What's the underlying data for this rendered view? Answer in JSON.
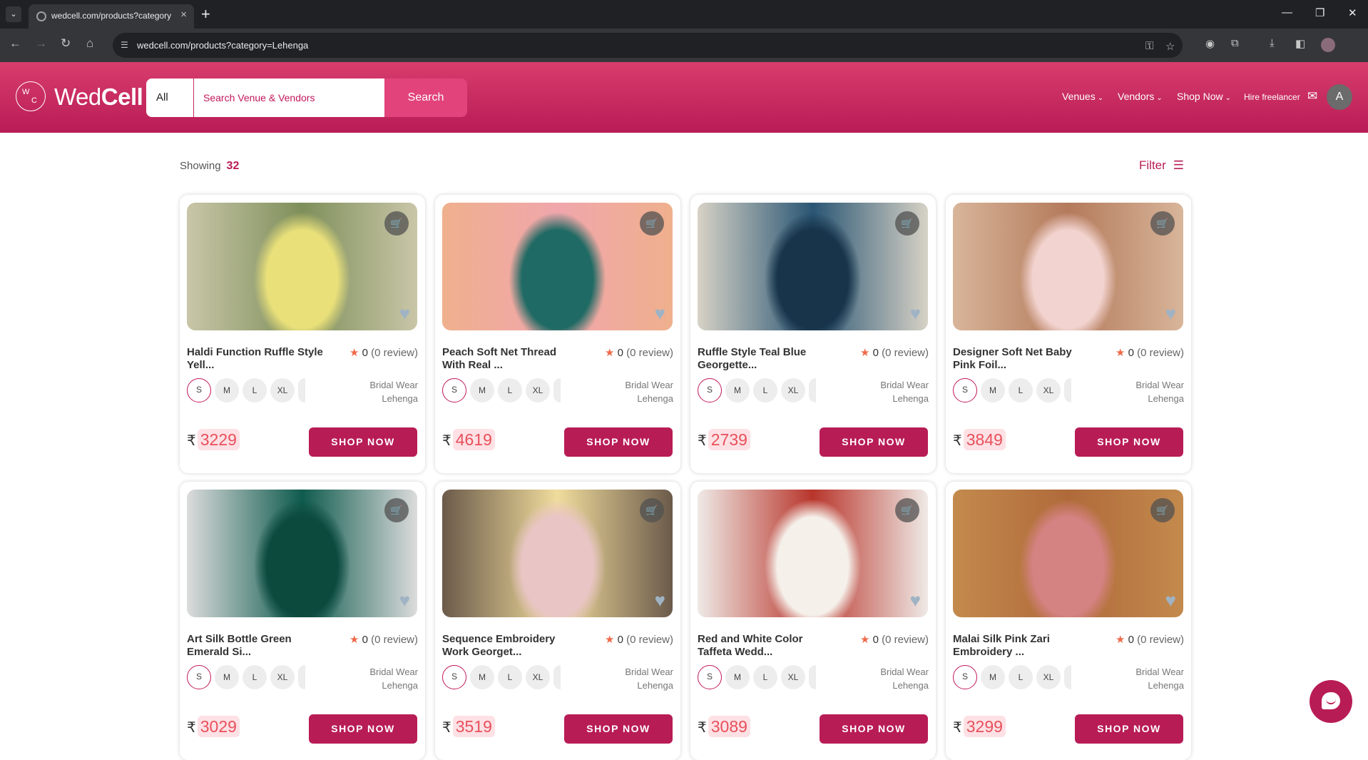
{
  "browser": {
    "tab_title": "wedcell.com/products?category=Lehenga",
    "url": "wedcell.com/products?category=Lehenga"
  },
  "site": {
    "logo_mark_w": "W",
    "logo_mark_c": "C",
    "logo_text_light": "Wed",
    "logo_text_bold": "Cell",
    "search_category": "All",
    "search_placeholder": "Search Venue & Vendors",
    "search_button": "Search",
    "nav": {
      "venues": "Venues",
      "vendors": "Vendors",
      "shop_now": "Shop Now",
      "hire_freelancer": "Hire freelancer"
    },
    "avatar_initial": "A"
  },
  "listing": {
    "showing_label": "Showing",
    "showing_count": "32",
    "filter_label": "Filter"
  },
  "products": [
    {
      "name_l1": "Haldi Function Ruffle Style",
      "name_l2": "Yell...",
      "rating": "0",
      "reviews": "(0 review)",
      "sizes": [
        "S",
        "M",
        "L",
        "XL"
      ],
      "cat1": "Bridal Wear",
      "cat2": "Lehenga",
      "currency": "₹",
      "price": "3229",
      "button": "SHOP NOW",
      "img_colors": [
        "#c9c6a8",
        "#e9e07a",
        "#7e8f5a"
      ],
      "cart_green": true
    },
    {
      "name_l1": "Peach Soft Net Thread",
      "name_l2": "With Real ...",
      "rating": "0",
      "reviews": "(0 review)",
      "sizes": [
        "S",
        "M",
        "L",
        "XL"
      ],
      "cat1": "Bridal Wear",
      "cat2": "Lehenga",
      "currency": "₹",
      "price": "4619",
      "button": "SHOP NOW",
      "img_colors": [
        "#efb08d",
        "#1f6a64",
        "#f0a6ac"
      ],
      "cart_green": true
    },
    {
      "name_l1": "Ruffle Style Teal Blue",
      "name_l2": "Georgette...",
      "rating": "0",
      "reviews": "(0 review)",
      "sizes": [
        "S",
        "M",
        "L",
        "XL"
      ],
      "cat1": "Bridal Wear",
      "cat2": "Lehenga",
      "currency": "₹",
      "price": "2739",
      "button": "SHOP NOW",
      "img_colors": [
        "#d7d2c6",
        "#17344b",
        "#2a5674"
      ],
      "cart_green": false
    },
    {
      "name_l1": "Designer Soft Net Baby",
      "name_l2": "Pink Foil...",
      "rating": "0",
      "reviews": "(0 review)",
      "sizes": [
        "S",
        "M",
        "L",
        "XL"
      ],
      "cat1": "Bridal Wear",
      "cat2": "Lehenga",
      "currency": "₹",
      "price": "3849",
      "button": "SHOP NOW",
      "img_colors": [
        "#d8b59a",
        "#f2d3cf",
        "#b47a5b"
      ],
      "cart_green": false
    },
    {
      "name_l1": "Art Silk Bottle Green",
      "name_l2": "Emerald Si...",
      "rating": "0",
      "reviews": "(0 review)",
      "sizes": [
        "S",
        "M",
        "L",
        "XL"
      ],
      "cat1": "Bridal Wear",
      "cat2": "Lehenga",
      "currency": "₹",
      "price": "3029",
      "button": "SHOP NOW",
      "img_colors": [
        "#dcdcdc",
        "#0c4a3e",
        "#0f5b4e"
      ],
      "cart_green": false
    },
    {
      "name_l1": "Sequence Embroidery",
      "name_l2": "Work Georget...",
      "rating": "0",
      "reviews": "(0 review)",
      "sizes": [
        "S",
        "M",
        "L",
        "XL"
      ],
      "cat1": "Bridal Wear",
      "cat2": "Lehenga",
      "currency": "₹",
      "price": "3519",
      "button": "SHOP NOW",
      "img_colors": [
        "#6b5a4a",
        "#e9c5c5",
        "#f0dc9c"
      ],
      "cart_green": false
    },
    {
      "name_l1": "Red and White Color",
      "name_l2": "Taffeta Wedd...",
      "rating": "0",
      "reviews": "(0 review)",
      "sizes": [
        "S",
        "M",
        "L",
        "XL"
      ],
      "cat1": "Bridal Wear",
      "cat2": "Lehenga",
      "currency": "₹",
      "price": "3089",
      "button": "SHOP NOW",
      "img_colors": [
        "#efeae6",
        "#f5f0ea",
        "#b8352b"
      ],
      "cart_green": false
    },
    {
      "name_l1": "Malai Silk Pink Zari",
      "name_l2": "Embroidery ...",
      "rating": "0",
      "reviews": "(0 review)",
      "sizes": [
        "S",
        "M",
        "L",
        "XL"
      ],
      "cat1": "Bridal Wear",
      "cat2": "Lehenga",
      "currency": "₹",
      "price": "3299",
      "button": "SHOP NOW",
      "img_colors": [
        "#c38a4d",
        "#d48282",
        "#b06a3a"
      ],
      "cart_green": false
    }
  ],
  "colors": {
    "brand": "#b81c55",
    "header_top": "#d83d6d",
    "price_bg": "#fde1e5",
    "price_text": "#e8505b"
  }
}
